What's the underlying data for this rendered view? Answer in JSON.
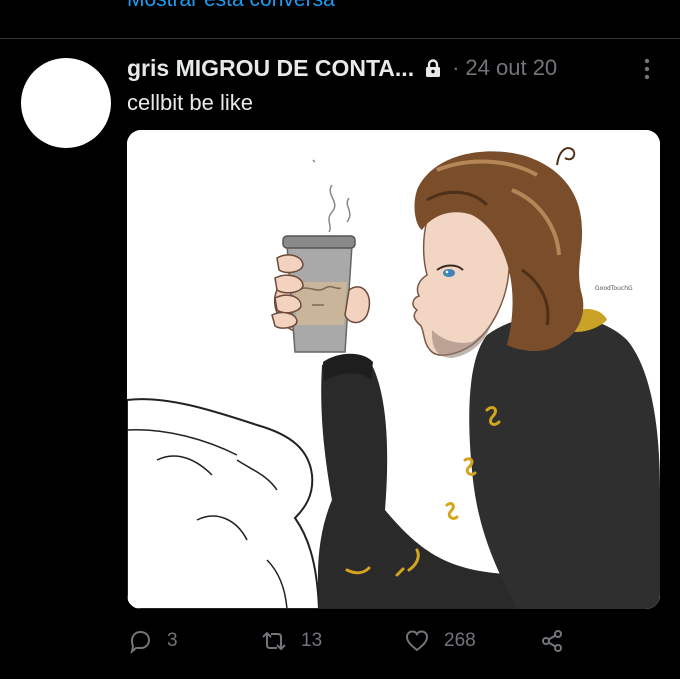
{
  "thread": {
    "show_conversation": "Mostrar esta conversa"
  },
  "tweet": {
    "display_name": "gris MIGROU DE CONTA...",
    "protected_icon": "lock-icon",
    "separator": "·",
    "timestamp": "24 out 20",
    "text": "cellbit be like",
    "media_signature": "GoodTouchG",
    "actions": {
      "reply_count": "3",
      "retweet_count": "13",
      "like_count": "268"
    }
  },
  "colors": {
    "background": "#000000",
    "text_primary": "#e7e9ea",
    "text_secondary": "#71767b",
    "link": "#1d9bf0",
    "divider": "#2f3336"
  }
}
